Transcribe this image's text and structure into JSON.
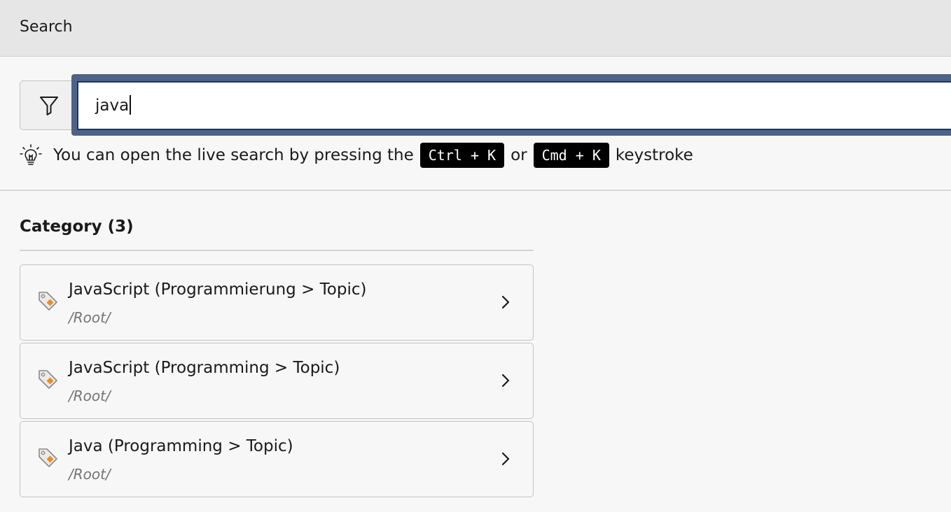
{
  "titlebar": {
    "title": "Search"
  },
  "search": {
    "value": "java",
    "filter_icon": "filter-icon"
  },
  "hint": {
    "icon": "lightbulb-icon",
    "text_before": "You can open the live search by pressing the",
    "kbd_1": "Ctrl + K",
    "text_or": "or",
    "kbd_2": "Cmd + K",
    "text_after": "keystroke"
  },
  "category": {
    "heading": "Category (3)",
    "items": [
      {
        "title": "JavaScript (Programmierung > Topic)",
        "path": "/Root/"
      },
      {
        "title": "JavaScript (Programming > Topic)",
        "path": "/Root/"
      },
      {
        "title": "Java (Programming > Topic)",
        "path": "/Root/"
      }
    ]
  },
  "colors": {
    "titlebar_bg": "#e6e6e6",
    "focus_ring": "#4c6388",
    "tag_accent": "#f08a24",
    "kbd_bg": "#000000"
  }
}
